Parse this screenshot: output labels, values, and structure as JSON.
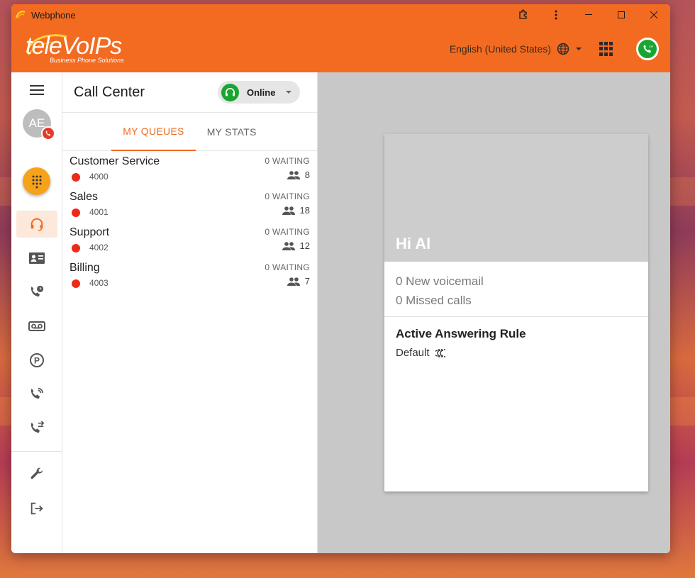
{
  "window": {
    "title": "Webphone"
  },
  "appbar": {
    "brand": "teleVoIPs",
    "brand_tagline": "Business Phone Solutions",
    "language": "English (United States)"
  },
  "sidebar": {
    "avatar_initials": "AE",
    "items": [
      {
        "name": "call-center",
        "icon": "headset-icon",
        "active": true
      },
      {
        "name": "contacts",
        "icon": "contact-card-icon",
        "active": false
      },
      {
        "name": "call-history",
        "icon": "phone-clock-icon",
        "active": false
      },
      {
        "name": "voicemail",
        "icon": "voicemail-icon",
        "active": false
      },
      {
        "name": "parking",
        "icon": "parking-icon",
        "active": false
      },
      {
        "name": "call-forward",
        "icon": "phone-ring-icon",
        "active": false
      },
      {
        "name": "call-transfer",
        "icon": "phone-transfer-icon",
        "active": false
      },
      {
        "name": "settings",
        "icon": "wrench-icon",
        "active": false
      },
      {
        "name": "logout",
        "icon": "logout-icon",
        "active": false
      }
    ]
  },
  "panel": {
    "title": "Call Center",
    "status": "Online",
    "tabs": [
      {
        "label": "MY QUEUES",
        "active": true
      },
      {
        "label": "MY STATS",
        "active": false
      }
    ],
    "queues": [
      {
        "name": "Customer Service",
        "ext": "4000",
        "waiting": "0 WAITING",
        "agents": "8"
      },
      {
        "name": "Sales",
        "ext": "4001",
        "waiting": "0 WAITING",
        "agents": "18"
      },
      {
        "name": "Support",
        "ext": "4002",
        "waiting": "0 WAITING",
        "agents": "12"
      },
      {
        "name": "Billing",
        "ext": "4003",
        "waiting": "0 WAITING",
        "agents": "7"
      }
    ]
  },
  "card": {
    "greeting": "Hi Al",
    "voicemail": "0 New voicemail",
    "missed": "0 Missed calls",
    "rule_title": "Active Answering Rule",
    "rule_value": "Default"
  },
  "colors": {
    "brand_orange": "#f26b21",
    "online_green": "#1aa532",
    "queue_dot_red": "#ed2a19",
    "fab_orange": "#f7a21b"
  }
}
